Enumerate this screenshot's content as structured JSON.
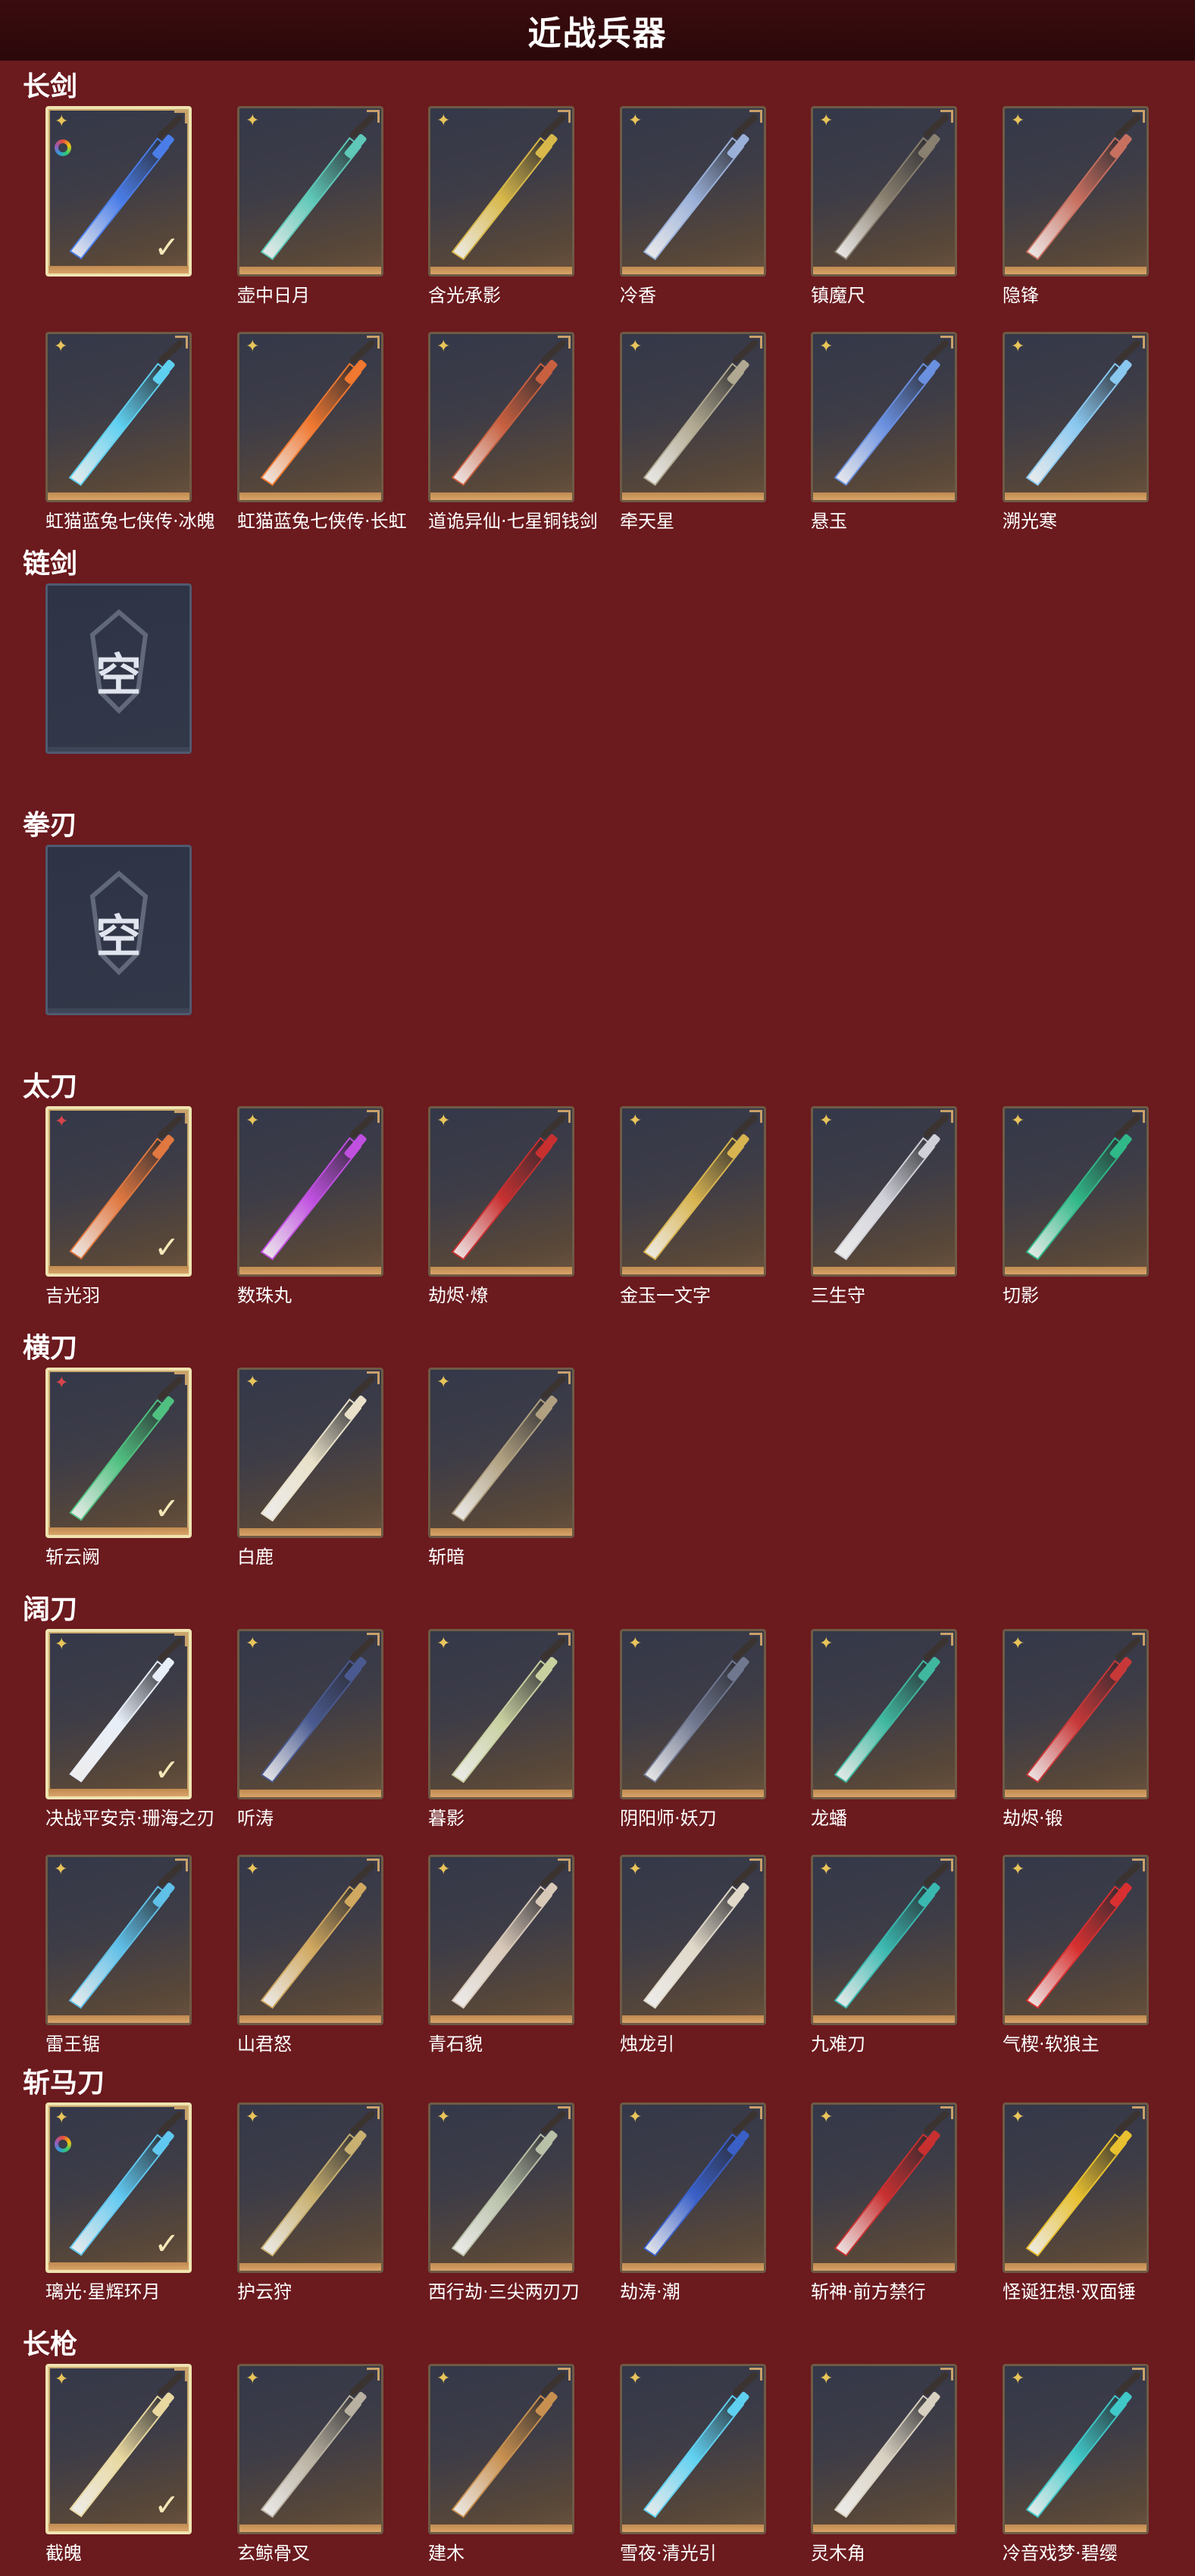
{
  "header": {
    "title": "近战兵器"
  },
  "empty_label": "空",
  "sections": [
    {
      "label": "长剑",
      "items": [
        {
          "name": "",
          "quality": "gold",
          "selected": true,
          "ring": true,
          "color": "#4a7de8"
        },
        {
          "name": "壶中日月",
          "quality": "gold",
          "color": "#5fc8b8"
        },
        {
          "name": "含光承影",
          "quality": "gold",
          "color": "#d8b84a"
        },
        {
          "name": "冷香",
          "quality": "gold",
          "color": "#9ab0d8"
        },
        {
          "name": "镇魔尺",
          "quality": "gold",
          "color": "#8a8070"
        },
        {
          "name": "隐锋",
          "quality": "gold",
          "color": "#c87060"
        },
        {
          "name": "虹猫蓝兔七侠传·冰魄",
          "quality": "gold",
          "color": "#5fd0f0"
        },
        {
          "name": "虹猫蓝兔七侠传·长虹",
          "quality": "gold",
          "color": "#f07830"
        },
        {
          "name": "道诡异仙·七星铜钱剑",
          "quality": "gold",
          "color": "#c86040"
        },
        {
          "name": "牵天星",
          "quality": "gold",
          "color": "#b0a890"
        },
        {
          "name": "悬玉",
          "quality": "gold",
          "color": "#6a90e0"
        },
        {
          "name": "溯光寒",
          "quality": "gold",
          "color": "#8ac8f0"
        }
      ]
    },
    {
      "label": "链剑",
      "items": [
        {
          "empty": true
        }
      ]
    },
    {
      "label": "拳刃",
      "items": [
        {
          "empty": true
        }
      ]
    },
    {
      "label": "太刀",
      "items": [
        {
          "name": "吉光羽",
          "quality": "red",
          "selected": true,
          "color": "#e07840"
        },
        {
          "name": "数珠丸",
          "quality": "gold",
          "color": "#c050e0"
        },
        {
          "name": "劫烬·燎",
          "quality": "gold",
          "color": "#c83030"
        },
        {
          "name": "金玉一文字",
          "quality": "gold",
          "color": "#d8b450"
        },
        {
          "name": "三生守",
          "quality": "gold",
          "color": "#d0d0d8"
        },
        {
          "name": "切影",
          "quality": "gold",
          "color": "#30b888"
        }
      ]
    },
    {
      "label": "横刀",
      "items": [
        {
          "name": "斩云阙",
          "quality": "red",
          "selected": true,
          "color": "#50c080"
        },
        {
          "name": "白鹿",
          "quality": "gold",
          "color": "#e8e0c8"
        },
        {
          "name": "斩暗",
          "quality": "gold",
          "color": "#b0a080"
        }
      ]
    },
    {
      "label": "阔刀",
      "items": [
        {
          "name": "决战平安京·珊海之刃",
          "quality": "gold",
          "selected": true,
          "color": "#e8eef8"
        },
        {
          "name": "听涛",
          "quality": "gold",
          "color": "#4a5a90"
        },
        {
          "name": "暮影",
          "quality": "gold",
          "color": "#c8d0a0"
        },
        {
          "name": "阴阳师·妖刀",
          "quality": "gold",
          "color": "#707890"
        },
        {
          "name": "龙蟠",
          "quality": "gold",
          "color": "#40b8a0"
        },
        {
          "name": "劫烬·锻",
          "quality": "gold",
          "color": "#c83838"
        },
        {
          "name": "雷王锯",
          "quality": "gold",
          "color": "#60c0e8"
        },
        {
          "name": "山君怒",
          "quality": "gold",
          "color": "#d0a860"
        },
        {
          "name": "青石貌",
          "quality": "gold",
          "color": "#d8c8b8"
        },
        {
          "name": "烛龙引",
          "quality": "gold",
          "color": "#e0d8c8"
        },
        {
          "name": "九难刀",
          "quality": "gold",
          "color": "#3ab8b0"
        },
        {
          "name": "气楔·软狼主",
          "quality": "gold",
          "color": "#d83030"
        }
      ]
    },
    {
      "label": "斩马刀",
      "items": [
        {
          "name": "璃光·星辉环月",
          "quality": "gold",
          "selected": true,
          "ring": true,
          "color": "#60c8f0"
        },
        {
          "name": "护云狩",
          "quality": "gold",
          "color": "#c8b070"
        },
        {
          "name": "西行劫·三尖两刃刀",
          "quality": "gold",
          "color": "#b8c0a8"
        },
        {
          "name": "劫涛·潮",
          "quality": "gold",
          "color": "#3a60c8"
        },
        {
          "name": "斩神·前方禁行",
          "quality": "gold",
          "color": "#c83030"
        },
        {
          "name": "怪诞狂想·双面锤",
          "quality": "gold",
          "color": "#e8c030"
        }
      ]
    },
    {
      "label": "长枪",
      "items": [
        {
          "name": "截魄",
          "quality": "gold",
          "selected": true,
          "color": "#e8d8a0"
        },
        {
          "name": "玄鲸骨叉",
          "quality": "gold",
          "color": "#b8b0a0"
        },
        {
          "name": "建木",
          "quality": "gold",
          "color": "#c89050"
        },
        {
          "name": "雪夜·清光引",
          "quality": "gold",
          "color": "#60d0f0"
        },
        {
          "name": "灵木角",
          "quality": "gold",
          "color": "#d8d0c0"
        },
        {
          "name": "冷音戏梦·碧缨",
          "quality": "gold",
          "color": "#40c8c8"
        }
      ]
    }
  ]
}
